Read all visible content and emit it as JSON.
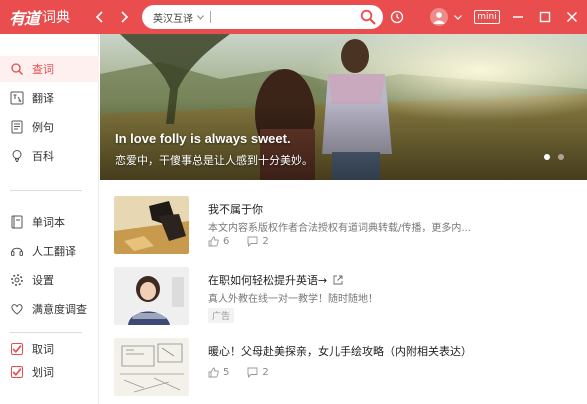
{
  "app": {
    "logo_text": "有道",
    "logo_sub": "词典"
  },
  "search": {
    "lang": "英汉互译",
    "value": "",
    "placeholder": ""
  },
  "titlebar": {
    "mini_label": "mini",
    "accent": "#e94d4d"
  },
  "sidebar": {
    "main_items": [
      {
        "label": "查词",
        "icon": "search-icon",
        "active": true
      },
      {
        "label": "翻译",
        "icon": "translate-icon"
      },
      {
        "label": "例句",
        "icon": "document-icon"
      },
      {
        "label": "百科",
        "icon": "bulb-icon"
      }
    ],
    "tool_items": [
      {
        "label": "单词本",
        "icon": "wordbook-icon"
      },
      {
        "label": "人工翻译",
        "icon": "headset-icon"
      },
      {
        "label": "设置",
        "icon": "gear-icon"
      },
      {
        "label": "满意度调查",
        "icon": "heart-icon"
      }
    ],
    "check_items": [
      {
        "label": "取词",
        "checked": true
      },
      {
        "label": "划词",
        "checked": true
      }
    ]
  },
  "banner": {
    "title": "In love folly is always sweet.",
    "subtitle": "恋爱中，干傻事总是让人感到十分美妙。"
  },
  "articles": [
    {
      "title": "我不属于你",
      "desc": "本文内容系版权作者合法授权有道词典转载/传播，更多内...",
      "likes": "6",
      "comments": "2"
    },
    {
      "title": "在职如何轻松提升英语→",
      "desc": "真人外教在线一对一教学！随时随地！",
      "ad": "广告"
    },
    {
      "title": "暖心！父母赴美探亲，女儿手绘攻略（内附相关表达）",
      "likes": "5",
      "comments": "2"
    }
  ]
}
